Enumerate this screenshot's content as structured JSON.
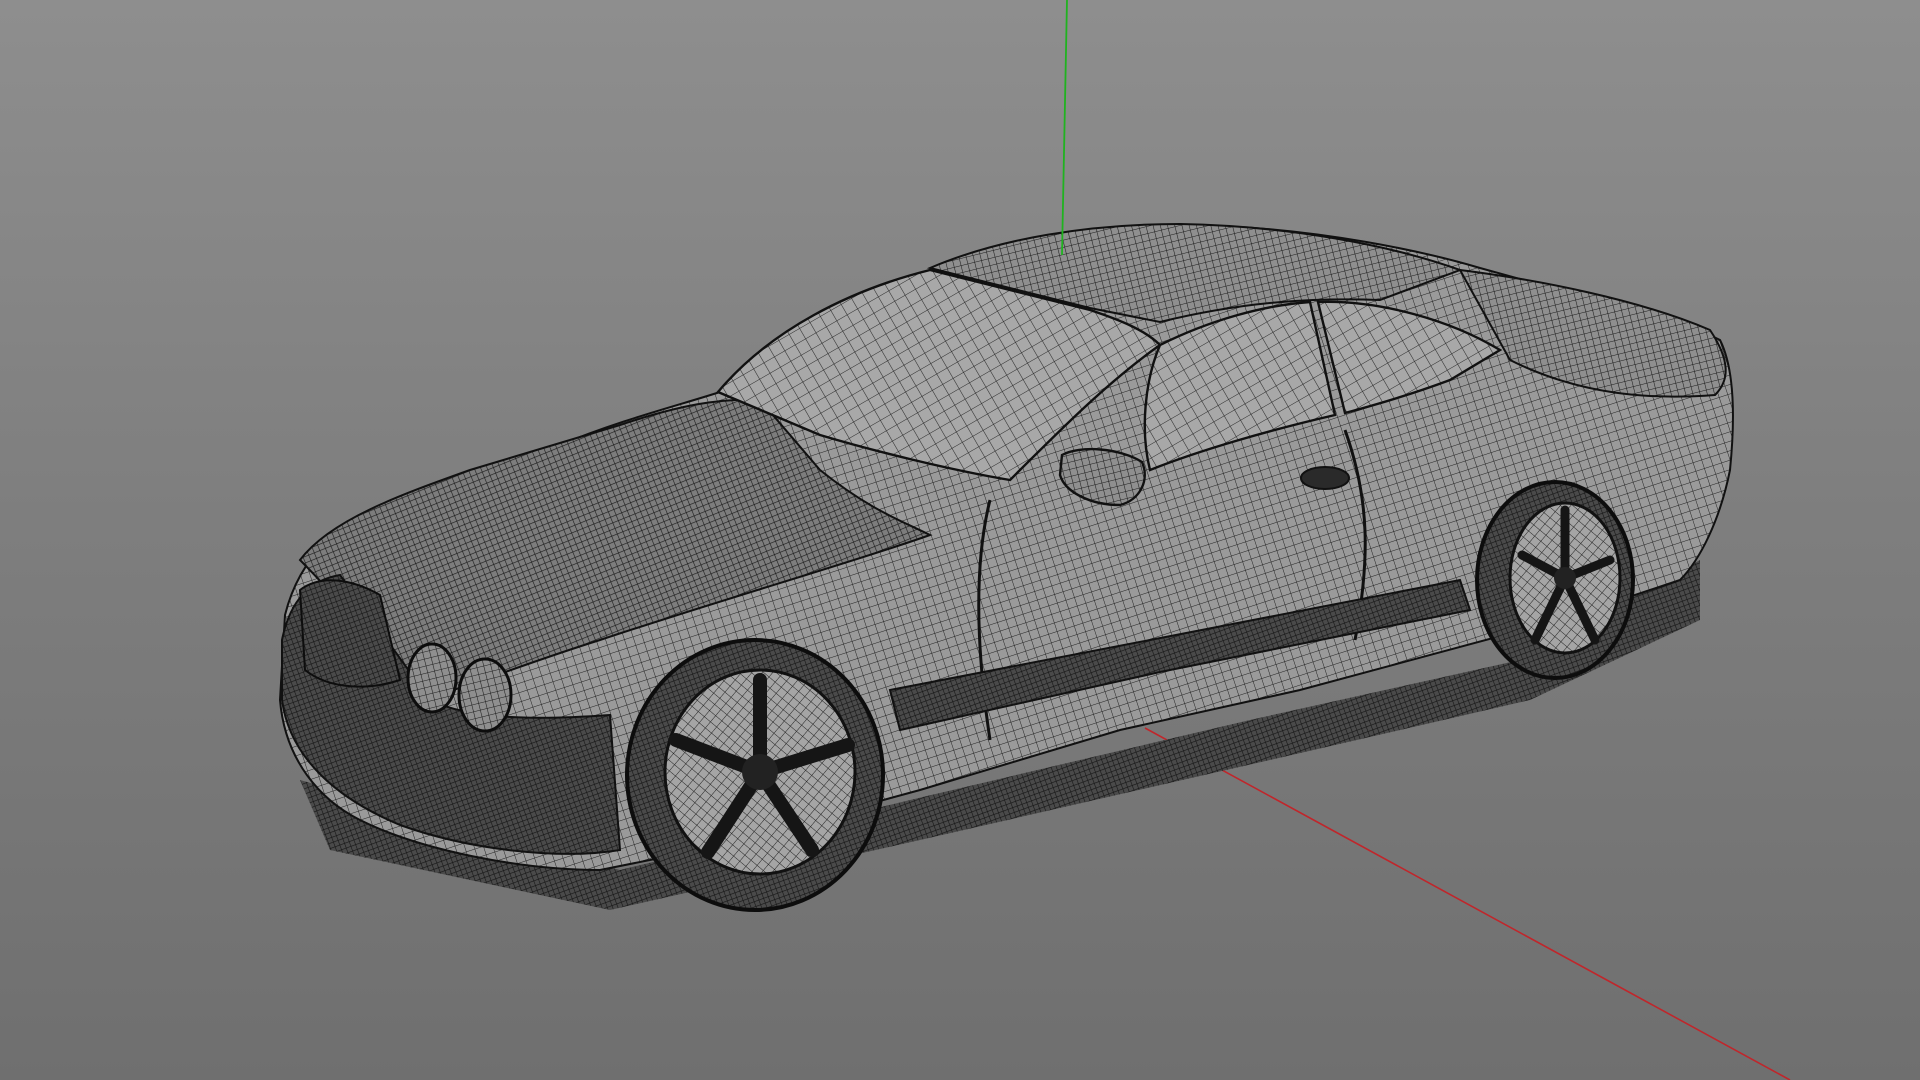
{
  "viewport": {
    "background_top": "#8e8e8e",
    "background_bottom": "#6f6f6f",
    "display_mode": "wireframe"
  },
  "axes": {
    "y_axis_color": "#1fb31f",
    "x_axis_color": "#c0262b"
  },
  "model": {
    "object": "car",
    "mesh_line_color": "#1c1c1c",
    "surface_color": "#9a9a9a"
  }
}
